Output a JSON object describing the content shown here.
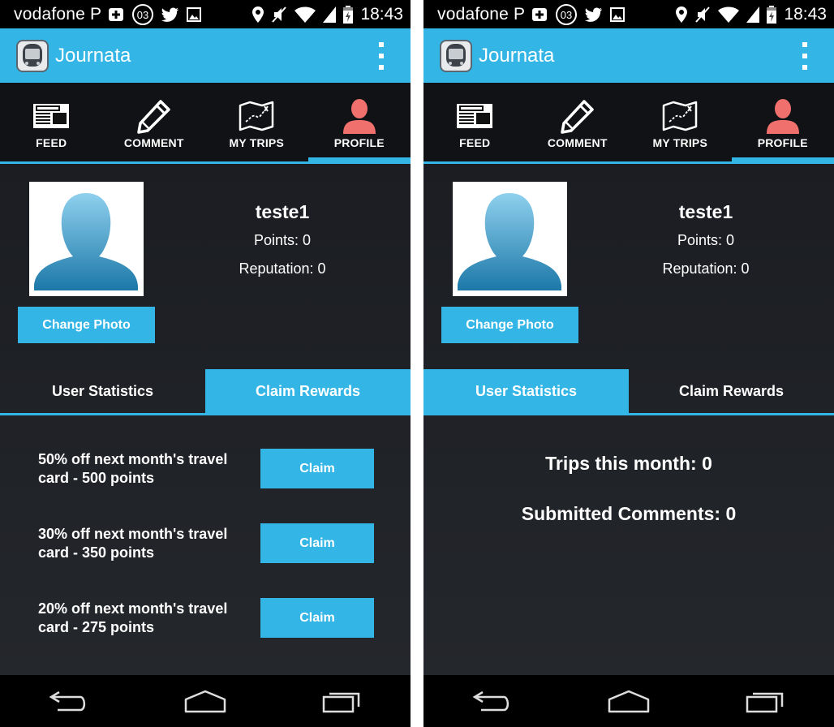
{
  "screens": [
    {
      "status_bar": {
        "carrier": "vodafone P",
        "notification_badge": "03",
        "time": "18:43"
      },
      "action_bar": {
        "app_title": "Journata"
      },
      "top_tabs": [
        {
          "label": "FEED",
          "icon": "newspaper-icon"
        },
        {
          "label": "COMMENT",
          "icon": "pencil-icon"
        },
        {
          "label": "MY TRIPS",
          "icon": "map-icon"
        },
        {
          "label": "PROFILE",
          "icon": "person-icon",
          "selected": true
        }
      ],
      "profile": {
        "username": "teste1",
        "points": "Points:  0",
        "reputation": "Reputation:  0",
        "change_photo_label": "Change Photo"
      },
      "sub_tabs": [
        {
          "label": "User Statistics",
          "selected": false
        },
        {
          "label": "Claim Rewards",
          "selected": true
        }
      ],
      "rewards": [
        {
          "line1": "50% off next month's travel",
          "line2": "card - 500 points",
          "claim_label": "Claim"
        },
        {
          "line1": "30% off next month's travel",
          "line2": "card - 350 points",
          "claim_label": "Claim"
        },
        {
          "line1": "20% off next month's travel",
          "line2": "card - 275 points",
          "claim_label": "Claim"
        }
      ]
    },
    {
      "status_bar": {
        "carrier": "vodafone P",
        "notification_badge": "03",
        "time": "18:43"
      },
      "action_bar": {
        "app_title": "Journata"
      },
      "top_tabs": [
        {
          "label": "FEED",
          "icon": "newspaper-icon"
        },
        {
          "label": "COMMENT",
          "icon": "pencil-icon"
        },
        {
          "label": "MY TRIPS",
          "icon": "map-icon"
        },
        {
          "label": "PROFILE",
          "icon": "person-icon",
          "selected": true
        }
      ],
      "profile": {
        "username": "teste1",
        "points": "Points:  0",
        "reputation": "Reputation:  0",
        "change_photo_label": "Change Photo"
      },
      "sub_tabs": [
        {
          "label": "User Statistics",
          "selected": true
        },
        {
          "label": "Claim Rewards",
          "selected": false
        }
      ],
      "stats": {
        "trips_this_month": "Trips this month: 0",
        "submitted_comments": "Submitted Comments: 0"
      }
    }
  ],
  "colors": {
    "accent": "#33b5e5",
    "profile_icon": "#f0706e",
    "background": "#111317"
  }
}
